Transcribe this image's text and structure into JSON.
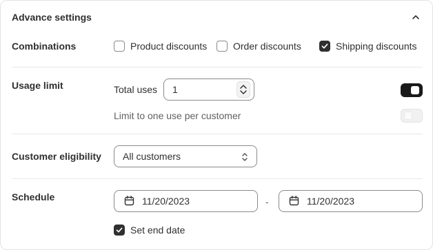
{
  "card": {
    "title": "Advance settings"
  },
  "combinations": {
    "label": "Combinations",
    "options": [
      {
        "label": "Product discounts",
        "checked": false
      },
      {
        "label": "Order discounts",
        "checked": false
      },
      {
        "label": "Shipping discounts",
        "checked": true
      }
    ]
  },
  "usage_limit": {
    "label": "Usage limit",
    "total_uses_label": "Total uses",
    "total_uses_value": "1",
    "total_uses_toggle_on": true,
    "one_per_customer_label": "Limit to one use per customer",
    "one_per_customer_toggle_on": false
  },
  "eligibility": {
    "label": "Customer eligibility",
    "selected": "All customers"
  },
  "schedule": {
    "label": "Schedule",
    "start_date": "11/20/2023",
    "separator": "-",
    "end_date": "11/20/2023",
    "set_end_date_label": "Set end date",
    "set_end_date_checked": true
  },
  "icons": {
    "header_toggle": "chevron-up-icon",
    "stepper": "stepper-icon",
    "select": "select-arrows-icon",
    "calendar": "calendar-icon",
    "check": "checkmark-icon"
  },
  "colors": {
    "text": "#303030",
    "muted": "#616161",
    "border": "#8a8a8a",
    "divider": "#e8e8e8",
    "toggle_on": "#1a1a1a"
  }
}
